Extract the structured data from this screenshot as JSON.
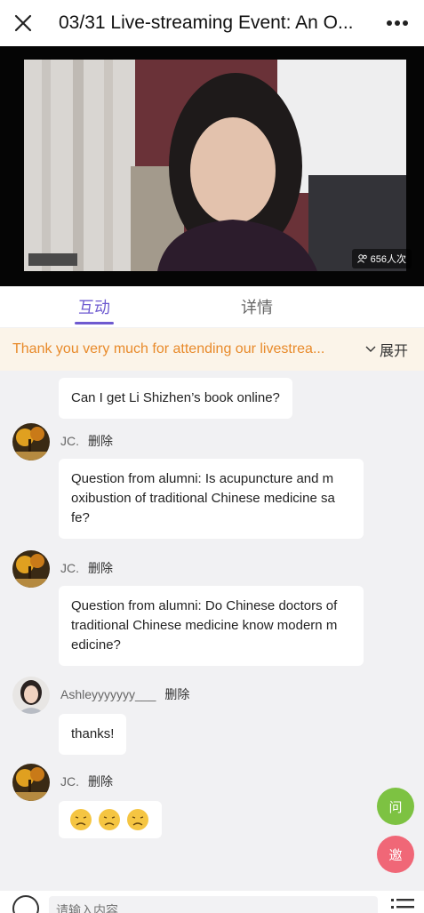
{
  "header": {
    "title": "03/31 Live-streaming Event: An O...",
    "close_icon": "close-icon",
    "more_icon": "more-horizontal-icon"
  },
  "video": {
    "viewer_count": "656人次"
  },
  "tabs": [
    {
      "label": "互动",
      "active": true
    },
    {
      "label": "详情",
      "active": false
    }
  ],
  "notice": {
    "text": "Thank you very much for attending our livestrea...",
    "expand_label": "展开"
  },
  "messages": [
    {
      "sender": "",
      "delete_label": "",
      "text": "Can I get Li Shizhen’s book online?"
    },
    {
      "sender": "JC.",
      "delete_label": "删除",
      "lines": [
        "Question from alumni: Is acupuncture and m",
        "oxibustion of traditional Chinese medicine sa",
        "fe?"
      ]
    },
    {
      "sender": "JC.",
      "delete_label": "删除",
      "lines": [
        "Question from alumni: Do Chinese doctors of",
        "traditional Chinese medicine know modern m",
        "edicine?"
      ]
    },
    {
      "sender": "Ashleyyyyyyy___",
      "delete_label": "删除",
      "text": "thanks!"
    },
    {
      "sender": "JC.",
      "delete_label": "删除",
      "emojis": 3
    }
  ],
  "floating": {
    "ask_label": "问",
    "invite_label": "邀"
  },
  "input": {
    "placeholder": "请输入内容"
  },
  "colors": {
    "accent": "#6e5ad0",
    "notice_text": "#e88a2a",
    "ask_button": "#7dc242",
    "invite_button": "#f06777"
  }
}
